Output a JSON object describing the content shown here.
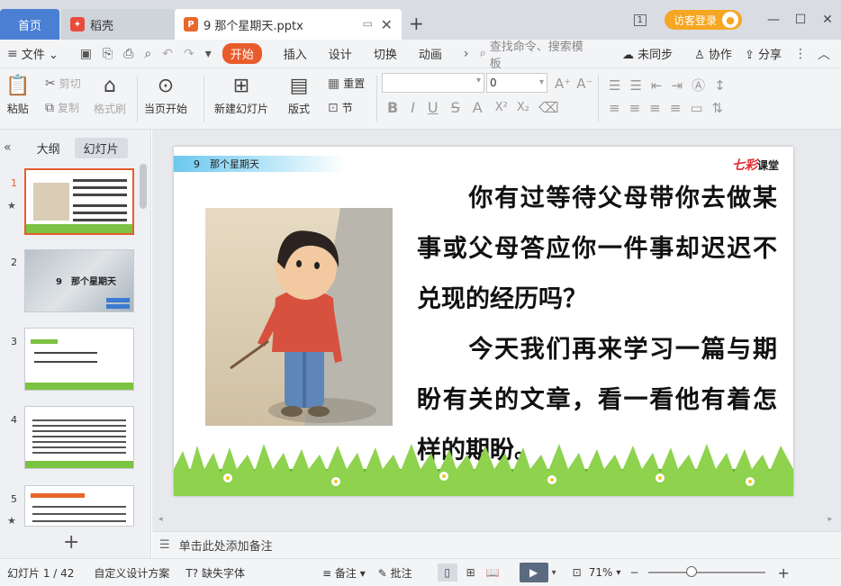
{
  "tabs": {
    "home": "首页",
    "daoke": "稻壳",
    "file": "9 那个星期天.pptx"
  },
  "account": {
    "login": "访客登录",
    "badge": "1"
  },
  "menu": {
    "file": "文件",
    "items": [
      "开始",
      "插入",
      "设计",
      "切换",
      "动画"
    ],
    "search_placeholder": "查找命令、搜索模板",
    "sync": "未同步",
    "collab": "协作",
    "share": "分享"
  },
  "ribbon": {
    "paste": "粘贴",
    "cut": "剪切",
    "copy": "复制",
    "format_painter": "格式刷",
    "play_current": "当页开始",
    "new_slide": "新建幻灯片",
    "layout": "版式",
    "reset": "重置",
    "section": "节",
    "font_size": "0"
  },
  "panel": {
    "outline_tab": "大纲",
    "slides_tab": "幻灯片",
    "slide_numbers": [
      "1",
      "2",
      "3",
      "4",
      "5"
    ],
    "thumb2_title": "9　那个星期天"
  },
  "slide": {
    "header_label": "9　那个星期天",
    "brand_a": "七彩",
    "brand_b": "课堂",
    "paragraph1": "　　你有过等待父母带你去做某事或父母答应你一件事却迟迟不兑现的经历吗？",
    "paragraph2": "　　今天我们再来学习一篇与期盼有关的文章，看一看他有着怎样的期盼。"
  },
  "notes_placeholder": "单击此处添加备注",
  "status": {
    "slide_count": "幻灯片 1 / 42",
    "theme": "自定义设计方案",
    "missing_font": "缺失字体",
    "notes": "备注",
    "comments": "批注",
    "zoom": "71%"
  },
  "colors": {
    "accent": "#e85c2b",
    "home_tab": "#4a7fd3",
    "login": "#f5a623"
  }
}
